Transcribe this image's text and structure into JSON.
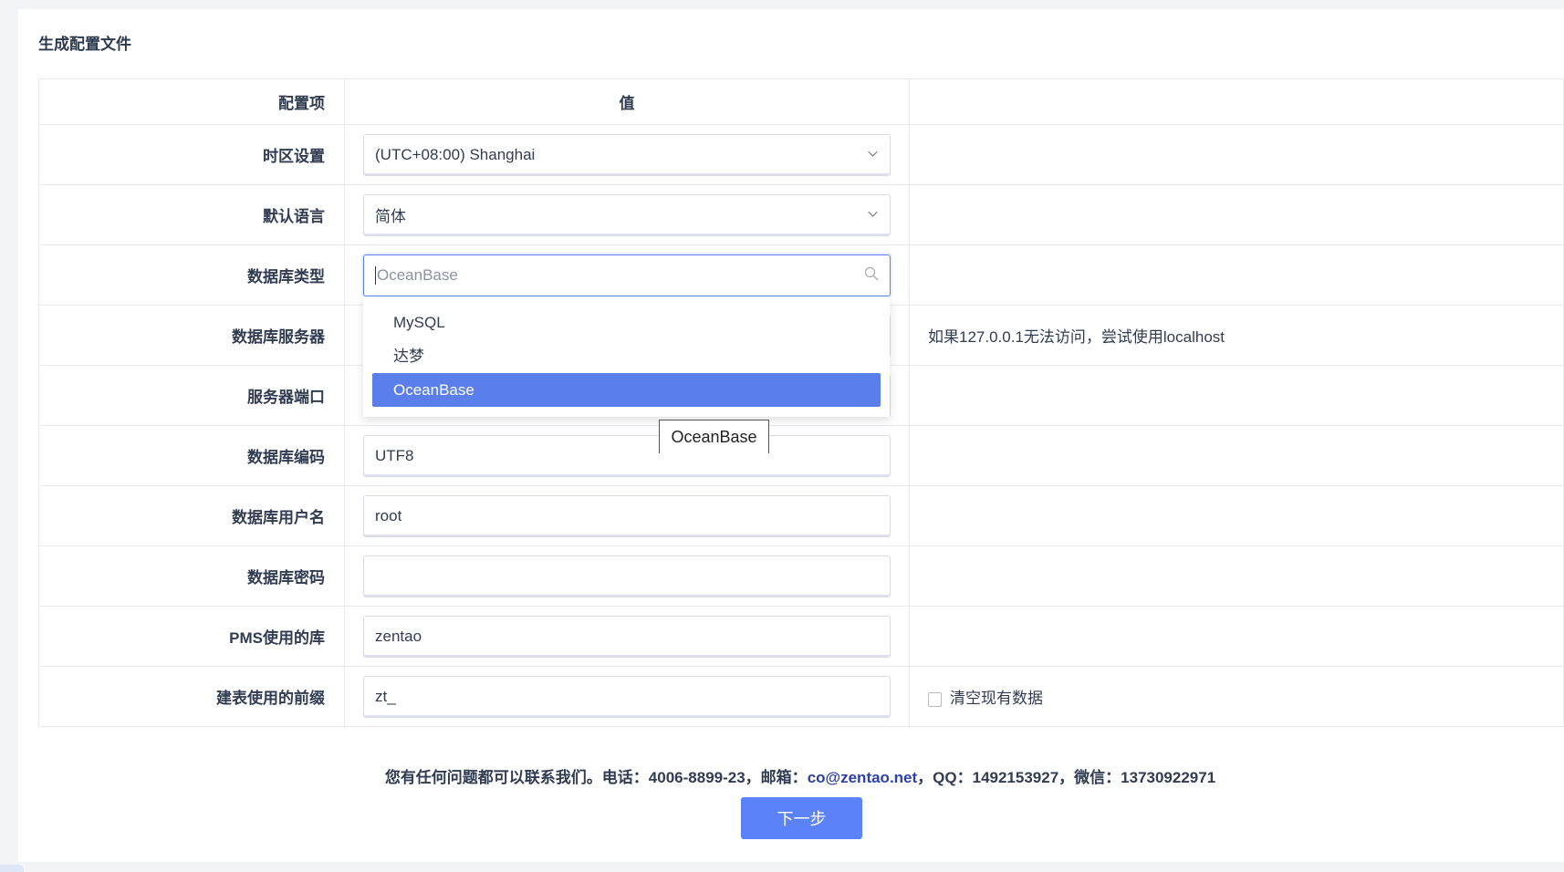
{
  "title": "生成配置文件",
  "headers": {
    "item": "配置项",
    "value": "值"
  },
  "rows": {
    "timezone": {
      "label": "时区设置",
      "value": "(UTC+08:00) Shanghai"
    },
    "language": {
      "label": "默认语言",
      "value": "简体"
    },
    "dbtype": {
      "label": "数据库类型",
      "placeholder": "OceanBase"
    },
    "dbhost": {
      "label": "数据库服务器",
      "hint": "如果127.0.0.1无法访问，尝试使用localhost"
    },
    "dbport": {
      "label": "服务器端口"
    },
    "encoding": {
      "label": "数据库编码",
      "value": "UTF8"
    },
    "user": {
      "label": "数据库用户名",
      "value": "root"
    },
    "password": {
      "label": "数据库密码",
      "value": ""
    },
    "dbname": {
      "label": "PMS使用的库",
      "value": "zentao"
    },
    "prefix": {
      "label": "建表使用的前缀",
      "value": "zt_",
      "checkbox": "清空现有数据"
    }
  },
  "dropdown": {
    "options": [
      "MySQL",
      "达梦",
      "OceanBase"
    ],
    "selected": "OceanBase"
  },
  "tooltip": "OceanBase",
  "footer": {
    "text1": "您有任何问题都可以联系我们。电话：4006-8899-23，邮箱：",
    "email": "co@zentao.net",
    "text2": "，QQ：1492153927，微信：13730922971"
  },
  "next_button": "下一步",
  "colors": {
    "accent": "#5c82fa",
    "selected": "#5a7eea"
  }
}
